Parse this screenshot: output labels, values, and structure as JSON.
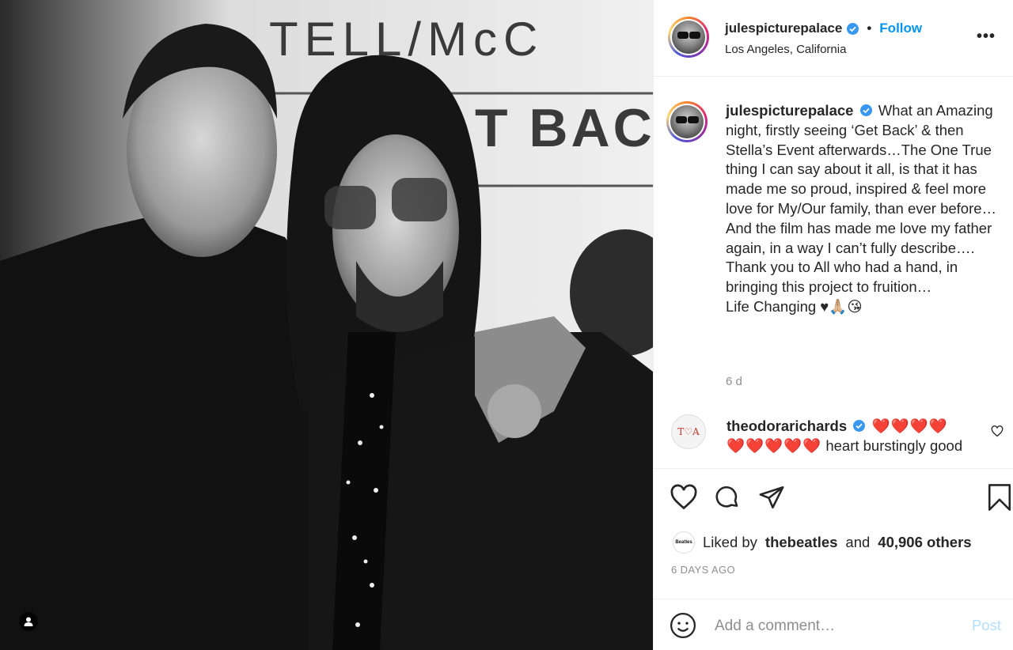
{
  "colors": {
    "accent": "#0095f6",
    "post_disabled": "#b2dffc",
    "text": "#262626",
    "muted": "#8e8e8e",
    "heart_red": "#e0162b"
  },
  "photo": {
    "backdrop_text_top": "TELL/McC",
    "backdrop_text_mid": "T BAC"
  },
  "header": {
    "username": "julespicturepalace",
    "separator": "•",
    "follow_label": "Follow",
    "location": "Los Angeles, California",
    "more_label": "•••"
  },
  "caption": {
    "username": "julespicturepalace",
    "lines": [
      "What an Amazing night, firstly seeing ‘Get Back’ & then Stella’s Event afterwards…The One True thing I can say about it all, is that it has made me so proud, inspired & feel more love for My/Our family, than ever before…",
      "And the film has made me love my father again, in a way I can’t fully describe….",
      "Thank you to All who had a hand, in bringing this project to fruition…",
      "Life Changing ♥🙏🏼😘"
    ],
    "time": "6 d"
  },
  "comment": {
    "avatar_text": "T♡A",
    "username": "theodorarichards",
    "hearts": "❤️❤️❤️❤️❤️❤️❤️❤️❤️",
    "text": "heart burstingly good"
  },
  "likes": {
    "prefix": "Liked by",
    "user": "thebeatles",
    "joiner": "and",
    "others": "40,906 others",
    "badge_text": "Beatles"
  },
  "posted": "6 DAYS AGO",
  "comment_box": {
    "placeholder": "Add a comment…",
    "post_label": "Post"
  }
}
